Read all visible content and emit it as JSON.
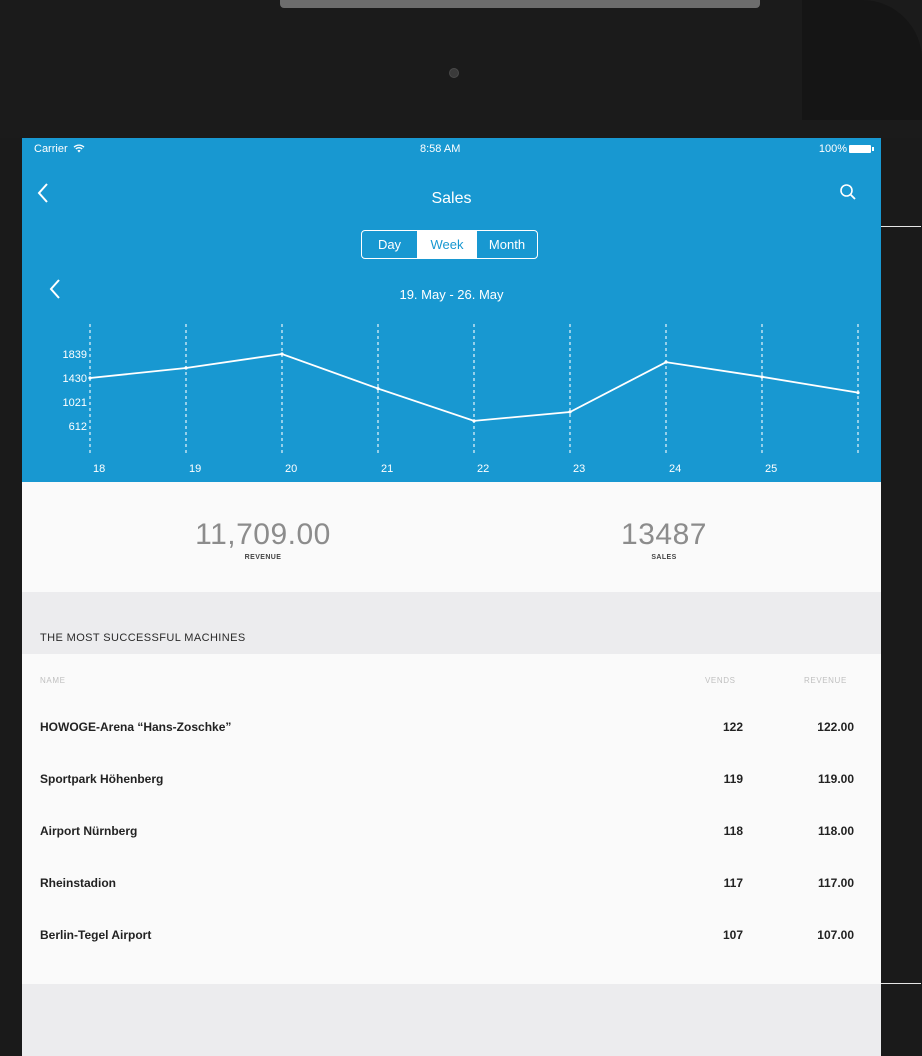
{
  "status_bar": {
    "carrier": "Carrier",
    "time": "8:58 AM",
    "battery": "100%"
  },
  "nav": {
    "title": "Sales"
  },
  "segments": [
    {
      "label": "Day",
      "active": false
    },
    {
      "label": "Week",
      "active": true
    },
    {
      "label": "Month",
      "active": false
    }
  ],
  "date_range": "19. May - 26. May",
  "chart_data": {
    "type": "line",
    "x": [
      "18",
      "19",
      "20",
      "21",
      "22",
      "23",
      "24",
      "25",
      ""
    ],
    "values": [
      1430,
      1600,
      1839,
      1250,
      700,
      850,
      1700,
      1450,
      1180
    ],
    "yticks": [
      "1839",
      "1430",
      "1021",
      "612"
    ],
    "ylim": [
      612,
      1839
    ],
    "grid": "vertical-dashed",
    "line_color": "#ffffff"
  },
  "summary": {
    "revenue_value": "11,709.00",
    "revenue_label": "REVENUE",
    "sales_value": "13487",
    "sales_label": "SALES"
  },
  "machines": {
    "title": "THE MOST SUCCESSFUL MACHINES",
    "columns": {
      "name": "NAME",
      "vends": "VENDS",
      "revenue": "REVENUE"
    },
    "rows": [
      {
        "name": "HOWOGE-Arena “Hans-Zoschke”",
        "vends": "122",
        "revenue": "122.00"
      },
      {
        "name": "Sportpark Höhenberg",
        "vends": "119",
        "revenue": "119.00"
      },
      {
        "name": "Airport Nürnberg",
        "vends": "118",
        "revenue": "118.00"
      },
      {
        "name": "Rheinstadion",
        "vends": "117",
        "revenue": "117.00"
      },
      {
        "name": "Berlin-Tegel Airport",
        "vends": "107",
        "revenue": "107.00"
      }
    ]
  },
  "colors": {
    "header_blue": "#1898d1",
    "section_grey": "#ececee"
  },
  "icons": [
    "wifi-icon",
    "battery-icon",
    "back-chevron-icon",
    "search-icon",
    "prev-range-chevron-icon",
    "camera"
  ]
}
